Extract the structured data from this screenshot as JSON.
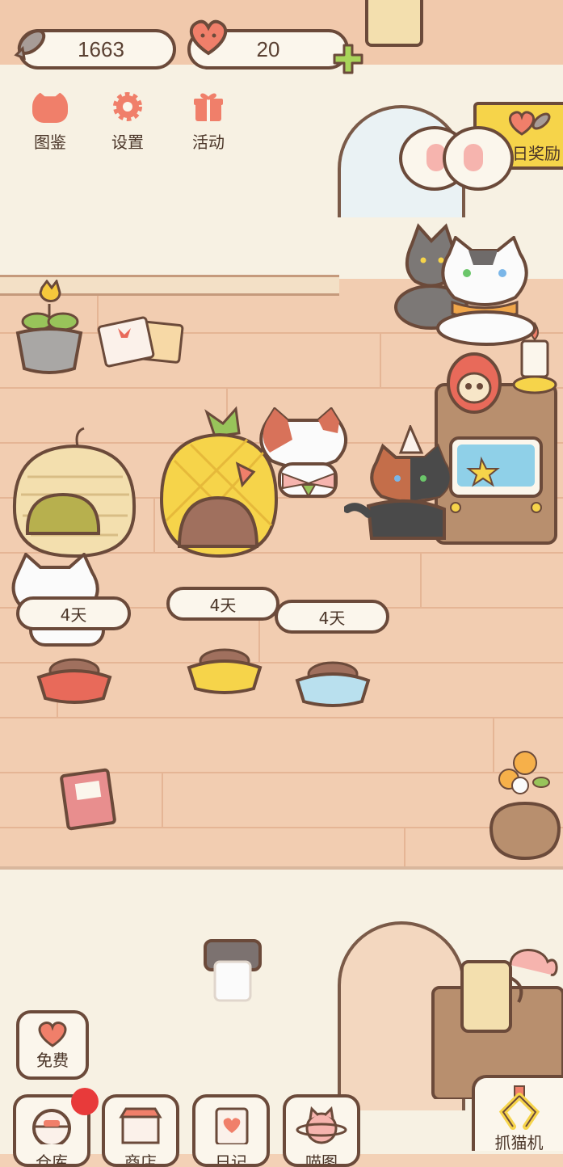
{
  "currency": {
    "fish_amount": "1663",
    "heart_amount": "20"
  },
  "menu": [
    {
      "label": "图鉴",
      "icon": "cat-head-icon"
    },
    {
      "label": "设置",
      "icon": "gear-icon"
    },
    {
      "label": "活动",
      "icon": "gift-icon"
    }
  ],
  "daily_reward": {
    "label": "每日奖励"
  },
  "food_bowls": [
    {
      "days": "4天"
    },
    {
      "days": "4天"
    },
    {
      "days": "4天"
    }
  ],
  "free_button": {
    "label": "免费"
  },
  "bottom_nav": [
    {
      "label": "仓库",
      "icon": "storage-icon",
      "badge": true
    },
    {
      "label": "商店",
      "icon": "shop-icon"
    },
    {
      "label": "日记",
      "icon": "diary-icon"
    },
    {
      "label": "喵图",
      "icon": "cat-planet-icon"
    }
  ],
  "claw_machine": {
    "label": "抓猫机"
  },
  "colors": {
    "outline": "#6b4a3a",
    "accent": "#f07f6a",
    "green_plus": "#a8d45a",
    "ribbon_yellow": "#f6d44a",
    "badge_red": "#e83a3a"
  }
}
